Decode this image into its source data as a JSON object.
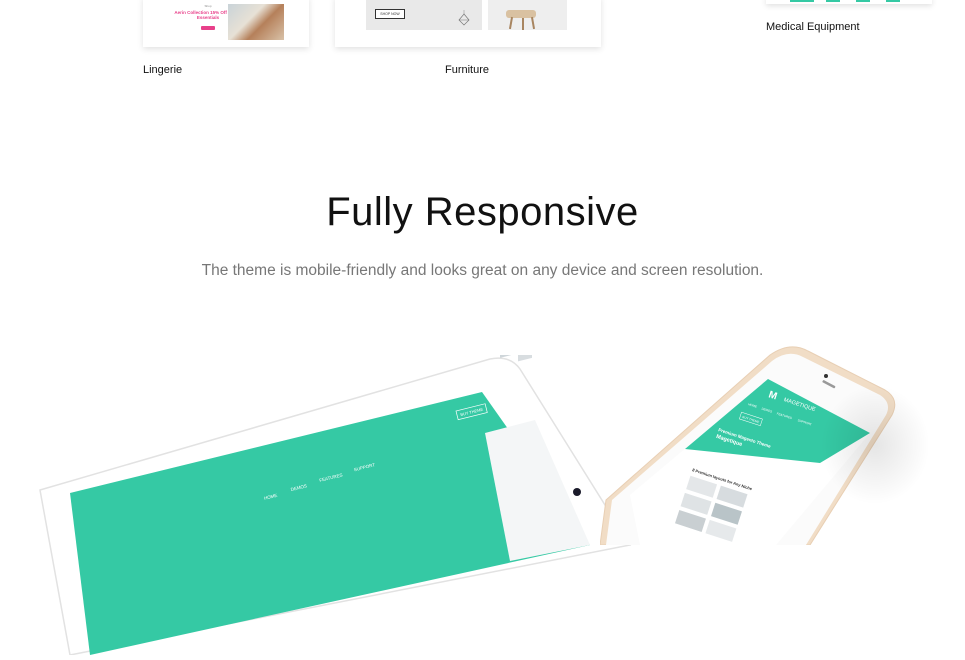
{
  "demos": [
    {
      "label": "Lingerie",
      "tiny": "Shop",
      "title": "Aerin Collection 15% Off Beach Essentials"
    },
    {
      "label": "Furniture",
      "button": "SHOP NOW"
    },
    {
      "label": "Medical Equipment"
    }
  ],
  "section": {
    "title": "Fully Responsive",
    "subtitle": "The theme is mobile-friendly and looks great on any device and screen resolution."
  },
  "tablet": {
    "nav": [
      "HOME",
      "DEMOS",
      "FEATURES",
      "SUPPORT"
    ],
    "buy_button": "BUY THEME"
  },
  "phone": {
    "brand": "MAGETIQUE",
    "nav": [
      "HOME",
      "DEMOS",
      "FEATURES",
      "SUPPORT"
    ],
    "buy_button": "BUY THEME",
    "headline": "Premium Magento Theme",
    "brand_line": "Magetique",
    "layouts": "8 Premium layouts for Any Niche"
  },
  "colors": {
    "accent": "#35c9a4",
    "pink": "#e8408a",
    "heading": "#111111",
    "subtitle": "#777777"
  }
}
